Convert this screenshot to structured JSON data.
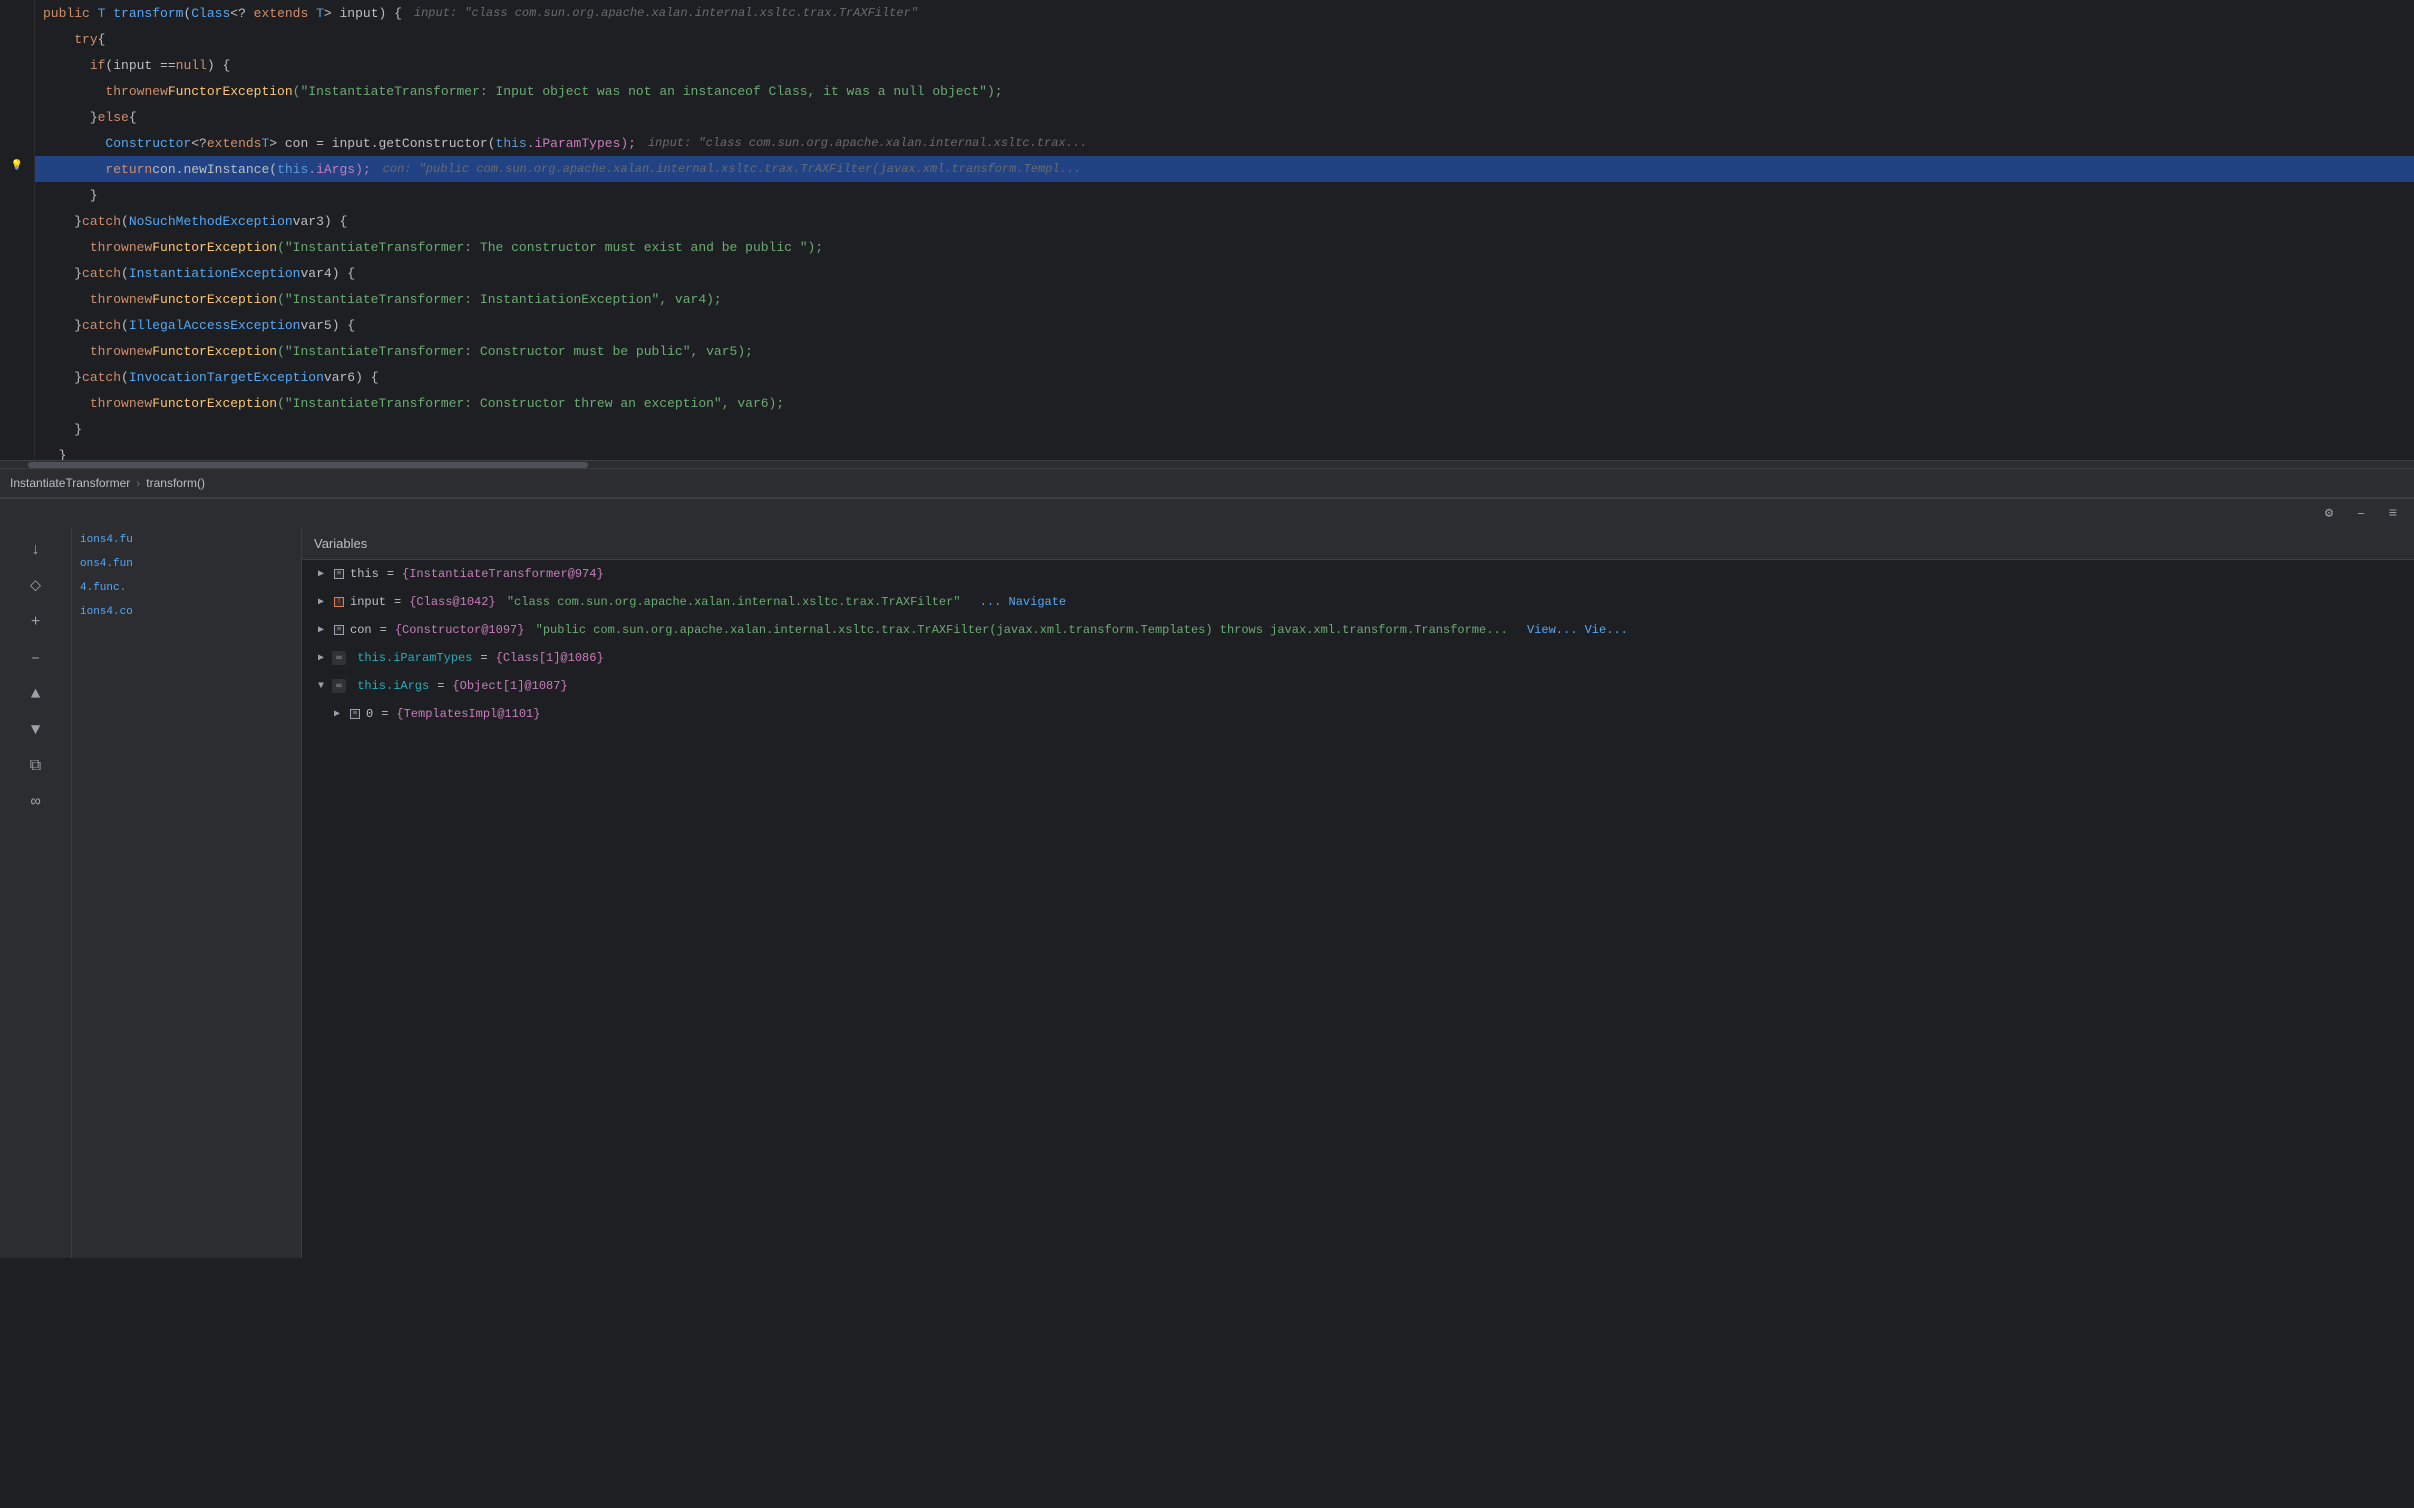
{
  "editor": {
    "lines": [
      {
        "id": 1,
        "gutter": "",
        "highlighted": false,
        "tokens": [
          {
            "t": "  ",
            "c": ""
          },
          {
            "t": "public",
            "c": "kw"
          },
          {
            "t": " T ",
            "c": "kw-blue"
          },
          {
            "t": "transform",
            "c": "method"
          },
          {
            "t": "(",
            "c": "punc"
          },
          {
            "t": "Class",
            "c": "type"
          },
          {
            "t": "<?",
            "c": "punc"
          },
          {
            "t": " extends ",
            "c": "kw"
          },
          {
            "t": "T",
            "c": "kw-blue"
          },
          {
            "t": "> input) {",
            "c": "punc"
          }
        ],
        "hint": "input: \"class com.sun.org.apache.xalan.internal.xsltc.trax.TrAXFilter\""
      },
      {
        "id": 2,
        "gutter": "",
        "highlighted": false,
        "tokens": [
          {
            "t": "    ",
            "c": ""
          },
          {
            "t": "try",
            "c": "kw"
          },
          {
            "t": " {",
            "c": "punc"
          }
        ],
        "hint": ""
      },
      {
        "id": 3,
        "gutter": "",
        "highlighted": false,
        "tokens": [
          {
            "t": "      ",
            "c": ""
          },
          {
            "t": "if",
            "c": "kw"
          },
          {
            "t": " (input == ",
            "c": "punc"
          },
          {
            "t": "null",
            "c": "kw"
          },
          {
            "t": ") {",
            "c": "punc"
          }
        ],
        "hint": ""
      },
      {
        "id": 4,
        "gutter": "",
        "highlighted": false,
        "tokens": [
          {
            "t": "        ",
            "c": ""
          },
          {
            "t": "throw",
            "c": "kw"
          },
          {
            "t": " ",
            "c": ""
          },
          {
            "t": "new",
            "c": "kw"
          },
          {
            "t": " ",
            "c": ""
          },
          {
            "t": "FunctorException",
            "c": "cls"
          },
          {
            "t": "(\"InstantiateTransformer: Input object was not an instanceof Class, it was a null object\");",
            "c": "string"
          }
        ],
        "hint": ""
      },
      {
        "id": 5,
        "gutter": "",
        "highlighted": false,
        "tokens": [
          {
            "t": "      } ",
            "c": "punc"
          },
          {
            "t": "else",
            "c": "kw"
          },
          {
            "t": " {",
            "c": "punc"
          }
        ],
        "hint": ""
      },
      {
        "id": 6,
        "gutter": "",
        "highlighted": false,
        "tokens": [
          {
            "t": "        ",
            "c": ""
          },
          {
            "t": "Constructor",
            "c": "type"
          },
          {
            "t": "<?",
            "c": "punc"
          },
          {
            "t": " extends ",
            "c": "kw"
          },
          {
            "t": "T",
            "c": "kw-blue"
          },
          {
            "t": "> con = input.getConstructor(",
            "c": "punc"
          },
          {
            "t": "this",
            "c": "kw-blue"
          },
          {
            "t": ".iParamTypes);",
            "c": "field"
          }
        ],
        "hint": "input: \"class com.sun.org.apache.xalan.internal.xsltc.trax..."
      },
      {
        "id": 7,
        "gutter": "lightbulb",
        "highlighted": true,
        "tokens": [
          {
            "t": "        ",
            "c": ""
          },
          {
            "t": "return",
            "c": "kw"
          },
          {
            "t": " con.newInstance(",
            "c": "punc"
          },
          {
            "t": "this",
            "c": "kw-blue"
          },
          {
            "t": ".iArgs);",
            "c": "field"
          }
        ],
        "hint": "con: \"public com.sun.org.apache.xalan.internal.xsltc.trax.TrAXFilter(javax.xml.transform.Templ..."
      },
      {
        "id": 8,
        "gutter": "",
        "highlighted": false,
        "tokens": [
          {
            "t": "      }",
            "c": "punc"
          }
        ],
        "hint": ""
      },
      {
        "id": 9,
        "gutter": "",
        "highlighted": false,
        "tokens": [
          {
            "t": "    } ",
            "c": "punc"
          },
          {
            "t": "catch",
            "c": "kw"
          },
          {
            "t": " (",
            "c": "punc"
          },
          {
            "t": "NoSuchMethodException",
            "c": "type"
          },
          {
            "t": " var3) {",
            "c": "punc"
          }
        ],
        "hint": ""
      },
      {
        "id": 10,
        "gutter": "",
        "highlighted": false,
        "tokens": [
          {
            "t": "      ",
            "c": ""
          },
          {
            "t": "throw",
            "c": "kw"
          },
          {
            "t": " ",
            "c": ""
          },
          {
            "t": "new",
            "c": "kw"
          },
          {
            "t": " ",
            "c": ""
          },
          {
            "t": "FunctorException",
            "c": "cls"
          },
          {
            "t": "(\"InstantiateTransformer: The constructor must exist and be public \");",
            "c": "string"
          }
        ],
        "hint": ""
      },
      {
        "id": 11,
        "gutter": "",
        "highlighted": false,
        "tokens": [
          {
            "t": "    } ",
            "c": "punc"
          },
          {
            "t": "catch",
            "c": "kw"
          },
          {
            "t": " (",
            "c": "punc"
          },
          {
            "t": "InstantiationException",
            "c": "type"
          },
          {
            "t": " var4) {",
            "c": "punc"
          }
        ],
        "hint": ""
      },
      {
        "id": 12,
        "gutter": "",
        "highlighted": false,
        "tokens": [
          {
            "t": "      ",
            "c": ""
          },
          {
            "t": "throw",
            "c": "kw"
          },
          {
            "t": " ",
            "c": ""
          },
          {
            "t": "new",
            "c": "kw"
          },
          {
            "t": " ",
            "c": ""
          },
          {
            "t": "FunctorException",
            "c": "cls"
          },
          {
            "t": "(\"InstantiateTransformer: InstantiationException\", var4);",
            "c": "string"
          }
        ],
        "hint": ""
      },
      {
        "id": 13,
        "gutter": "",
        "highlighted": false,
        "tokens": [
          {
            "t": "    } ",
            "c": "punc"
          },
          {
            "t": "catch",
            "c": "kw"
          },
          {
            "t": " (",
            "c": "punc"
          },
          {
            "t": "IllegalAccessException",
            "c": "type"
          },
          {
            "t": " var5) {",
            "c": "punc"
          }
        ],
        "hint": ""
      },
      {
        "id": 14,
        "gutter": "",
        "highlighted": false,
        "tokens": [
          {
            "t": "      ",
            "c": ""
          },
          {
            "t": "throw",
            "c": "kw"
          },
          {
            "t": " ",
            "c": ""
          },
          {
            "t": "new",
            "c": "kw"
          },
          {
            "t": " ",
            "c": ""
          },
          {
            "t": "FunctorException",
            "c": "cls"
          },
          {
            "t": "(\"InstantiateTransformer: Constructor must be public\", var5);",
            "c": "string"
          }
        ],
        "hint": ""
      },
      {
        "id": 15,
        "gutter": "",
        "highlighted": false,
        "tokens": [
          {
            "t": "    } ",
            "c": "punc"
          },
          {
            "t": "catch",
            "c": "kw"
          },
          {
            "t": " (",
            "c": "punc"
          },
          {
            "t": "InvocationTargetException",
            "c": "type"
          },
          {
            "t": " var6) {",
            "c": "punc"
          }
        ],
        "hint": ""
      },
      {
        "id": 16,
        "gutter": "",
        "highlighted": false,
        "tokens": [
          {
            "t": "      ",
            "c": ""
          },
          {
            "t": "throw",
            "c": "kw"
          },
          {
            "t": " ",
            "c": ""
          },
          {
            "t": "new",
            "c": "kw"
          },
          {
            "t": " ",
            "c": ""
          },
          {
            "t": "FunctorException",
            "c": "cls"
          },
          {
            "t": "(\"InstantiateTransformer: Constructor threw an exception\", var6);",
            "c": "string"
          }
        ],
        "hint": ""
      },
      {
        "id": 17,
        "gutter": "",
        "highlighted": false,
        "tokens": [
          {
            "t": "    }",
            "c": "punc"
          }
        ],
        "hint": ""
      },
      {
        "id": 18,
        "gutter": "",
        "highlighted": false,
        "tokens": [
          {
            "t": "  }",
            "c": "punc"
          }
        ],
        "hint": ""
      }
    ],
    "breadcrumb": {
      "class": "InstantiateTransformer",
      "method": "transform()"
    }
  },
  "toolbar": {
    "settings_label": "⚙",
    "minus_label": "–",
    "lines_label": "≡"
  },
  "debugger": {
    "variables_header": "Variables",
    "buttons": {
      "step_over": "↓",
      "step_filter": "⬦",
      "step_add": "+",
      "step_minus": "–",
      "step_up": "▲",
      "step_down": "▼",
      "step_copy": "⧉",
      "step_view": "∞"
    },
    "frames": [
      "ions4.fu",
      "ons4.fun",
      "4.func.",
      "ions4.co"
    ],
    "variables": [
      {
        "indent": 0,
        "expanded": true,
        "icon": "rect-gray",
        "name": "this",
        "equals": "=",
        "value": "{InstantiateTransformer@974}",
        "extra": ""
      },
      {
        "indent": 0,
        "expanded": false,
        "icon": "rect-orange",
        "name": "input",
        "equals": "=",
        "value": "{Class@1042}",
        "string": "\"class com.sun.org.apache.xalan.internal.xsltc.trax.TrAXFilter\"",
        "navigate": "... Navigate"
      },
      {
        "indent": 0,
        "expanded": false,
        "icon": "rect-gray",
        "name": "con",
        "equals": "=",
        "value": "{Constructor@1097}",
        "string": "\"public com.sun.org.apache.xalan.internal.xsltc.trax.TrAXFilter(javax.xml.transform.Templates) throws javax.xml.transform.Transforme...",
        "view": "View... Vie..."
      },
      {
        "indent": 0,
        "expanded": false,
        "icon": "infinity",
        "name": "this.iParamTypes",
        "equals": "=",
        "value": "{Class[1]@1086}",
        "extra": ""
      },
      {
        "indent": 0,
        "expanded": true,
        "icon": "infinity",
        "name": "this.iArgs",
        "equals": "=",
        "value": "{Object[1]@1087}",
        "extra": ""
      },
      {
        "indent": 1,
        "expanded": false,
        "icon": "rect-gray",
        "name": "0",
        "equals": "=",
        "value": "{TemplatesImpl@1101}",
        "extra": ""
      }
    ]
  }
}
